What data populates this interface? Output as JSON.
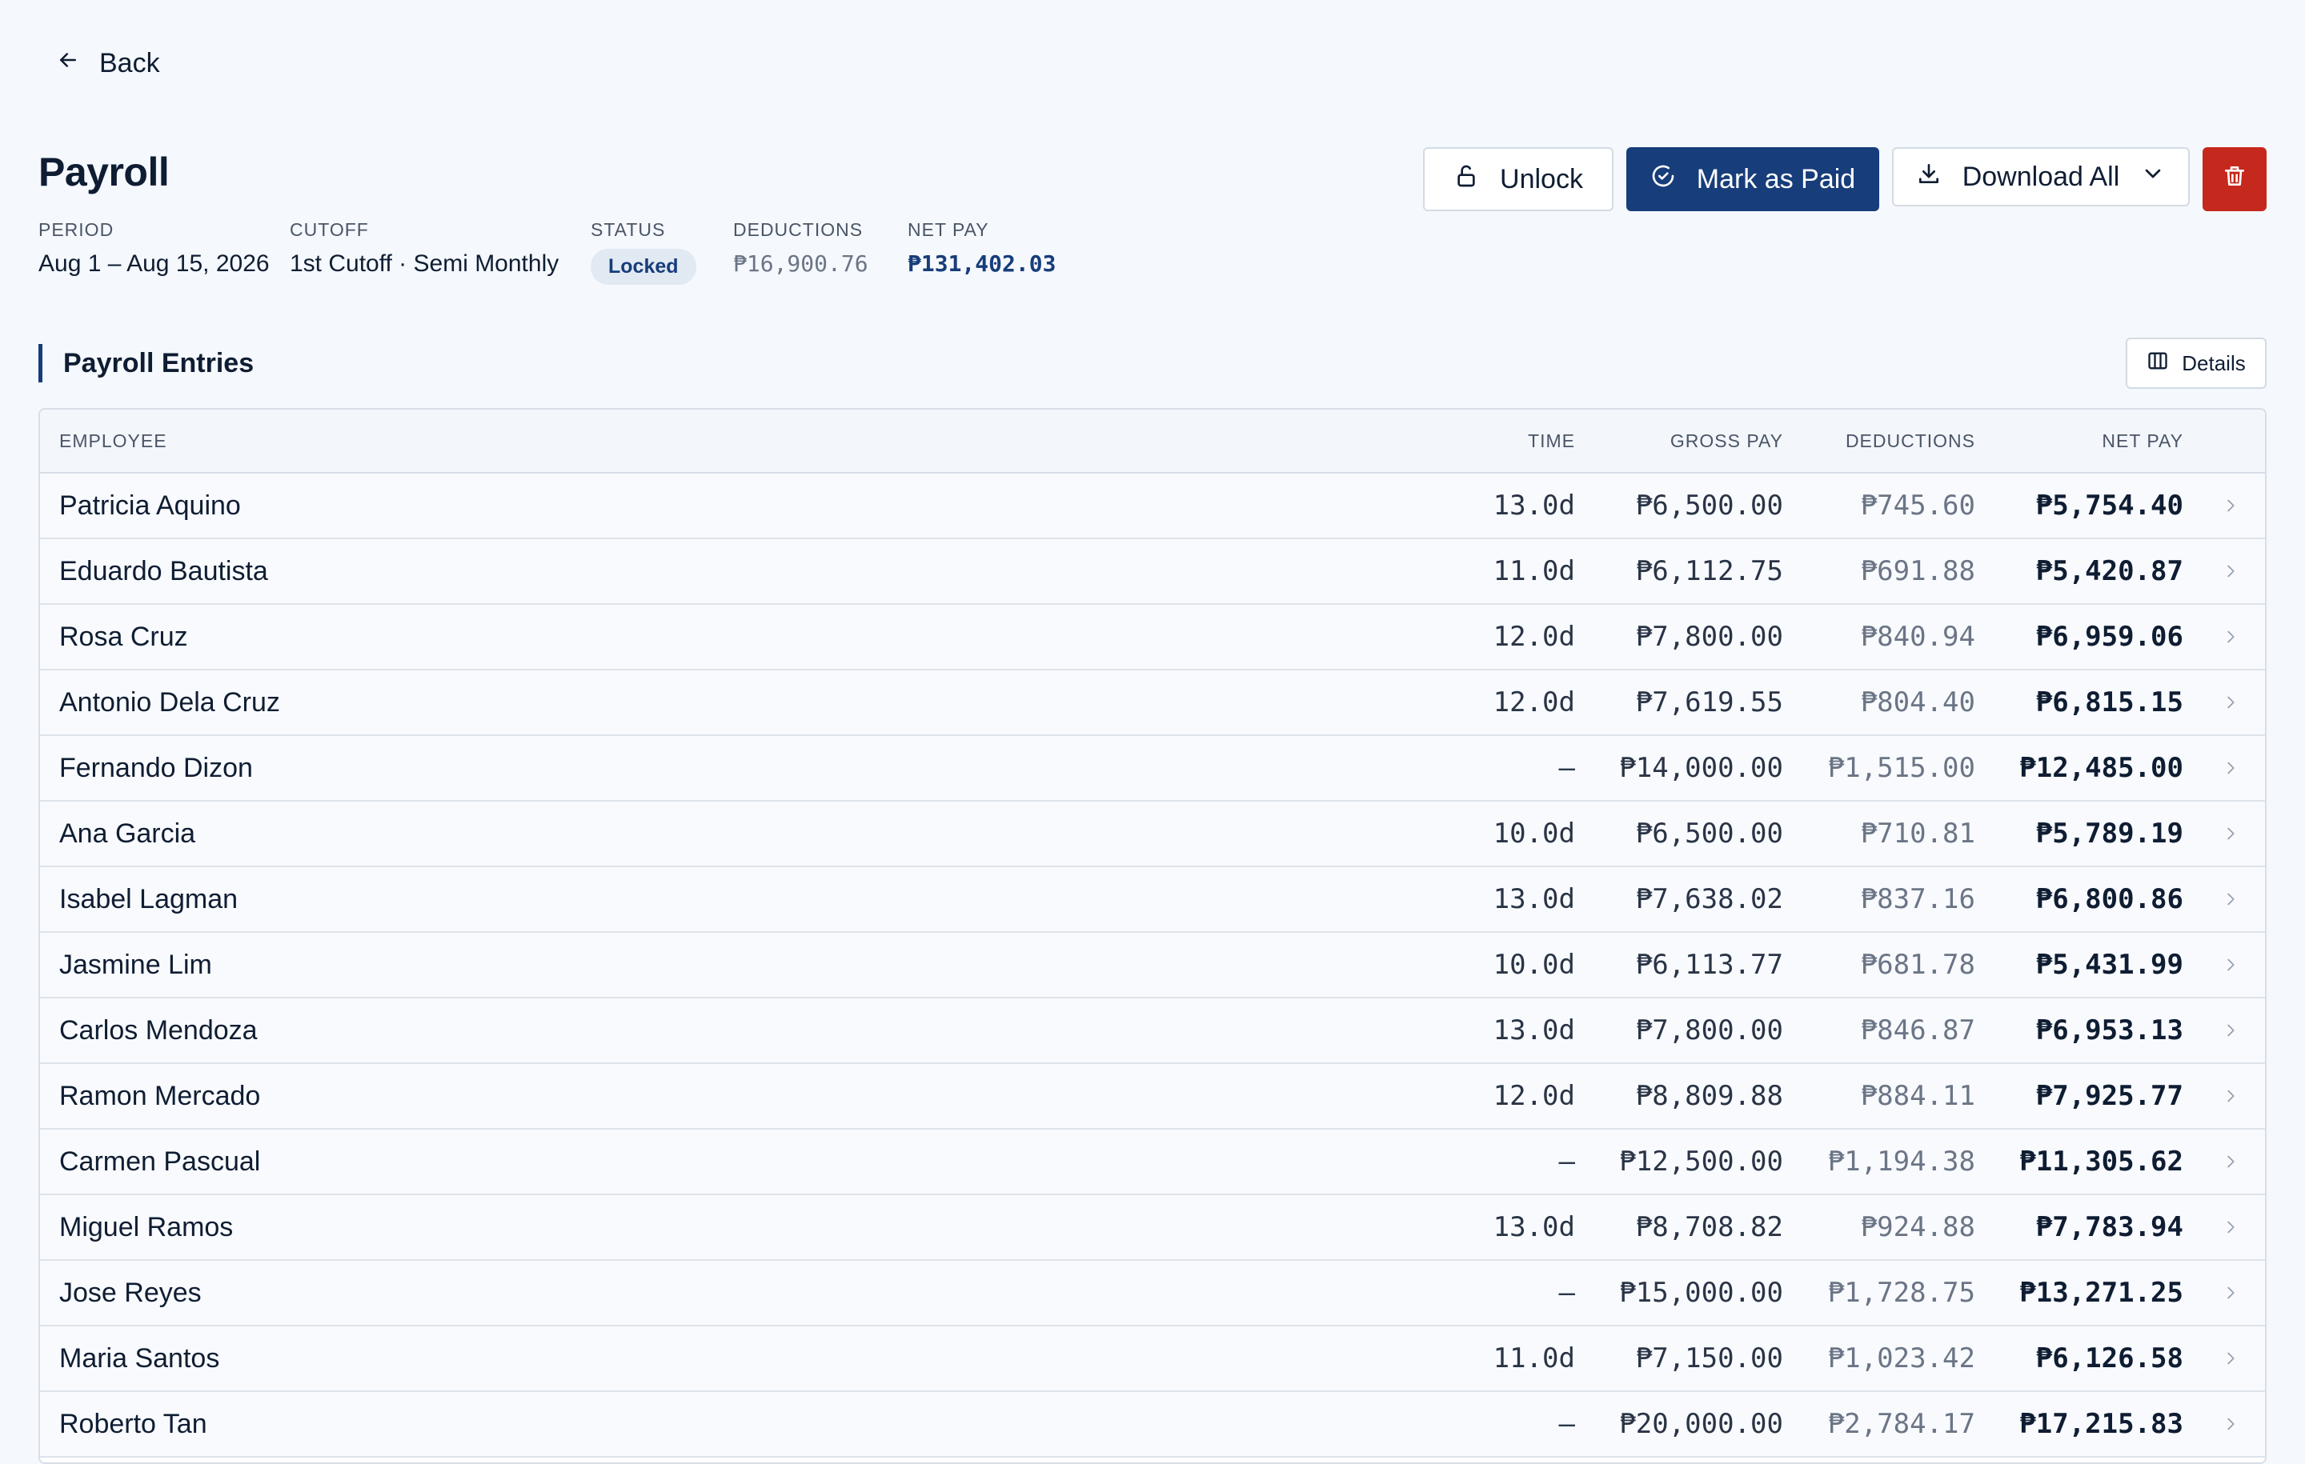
{
  "nav": {
    "back_label": "Back"
  },
  "page": {
    "title": "Payroll"
  },
  "meta": {
    "period_label": "PERIOD",
    "period_value": "Aug 1 – Aug 15, 2026",
    "cutoff_label": "CUTOFF",
    "cutoff_value": "1st Cutoff · Semi Monthly",
    "status_label": "STATUS",
    "status_value": "Locked",
    "deductions_label": "DEDUCTIONS",
    "deductions_value": "₱16,900.76",
    "netpay_label": "NET PAY",
    "netpay_value": "₱131,402.03"
  },
  "actions": {
    "unlock_label": "Unlock",
    "mark_paid_label": "Mark as Paid",
    "download_label": "Download All"
  },
  "section": {
    "title": "Payroll Entries",
    "details_label": "Details"
  },
  "table": {
    "columns": [
      "EMPLOYEE",
      "TIME",
      "GROSS PAY",
      "DEDUCTIONS",
      "NET PAY"
    ],
    "rows": [
      [
        "Patricia Aquino",
        "13.0d",
        "₱6,500.00",
        "₱745.60",
        "₱5,754.40"
      ],
      [
        "Eduardo Bautista",
        "11.0d",
        "₱6,112.75",
        "₱691.88",
        "₱5,420.87"
      ],
      [
        "Rosa Cruz",
        "12.0d",
        "₱7,800.00",
        "₱840.94",
        "₱6,959.06"
      ],
      [
        "Antonio Dela Cruz",
        "12.0d",
        "₱7,619.55",
        "₱804.40",
        "₱6,815.15"
      ],
      [
        "Fernando Dizon",
        "—",
        "₱14,000.00",
        "₱1,515.00",
        "₱12,485.00"
      ],
      [
        "Ana Garcia",
        "10.0d",
        "₱6,500.00",
        "₱710.81",
        "₱5,789.19"
      ],
      [
        "Isabel Lagman",
        "13.0d",
        "₱7,638.02",
        "₱837.16",
        "₱6,800.86"
      ],
      [
        "Jasmine Lim",
        "10.0d",
        "₱6,113.77",
        "₱681.78",
        "₱5,431.99"
      ],
      [
        "Carlos Mendoza",
        "13.0d",
        "₱7,800.00",
        "₱846.87",
        "₱6,953.13"
      ],
      [
        "Ramon Mercado",
        "12.0d",
        "₱8,809.88",
        "₱884.11",
        "₱7,925.77"
      ],
      [
        "Carmen Pascual",
        "—",
        "₱12,500.00",
        "₱1,194.38",
        "₱11,305.62"
      ],
      [
        "Miguel Ramos",
        "13.0d",
        "₱8,708.82",
        "₱924.88",
        "₱7,783.94"
      ],
      [
        "Jose Reyes",
        "—",
        "₱15,000.00",
        "₱1,728.75",
        "₱13,271.25"
      ],
      [
        "Maria Santos",
        "11.0d",
        "₱7,150.00",
        "₱1,023.42",
        "₱6,126.58"
      ],
      [
        "Roberto Tan",
        "—",
        "₱20,000.00",
        "₱2,784.17",
        "₱17,215.83"
      ]
    ]
  },
  "colors": {
    "primary": "#173d7a",
    "danger": "#c5281c",
    "background": "#f5f8fc"
  },
  "icons": [
    "arrow-left-icon",
    "unlock-icon",
    "check-circle-icon",
    "download-icon",
    "chevron-down-icon",
    "trash-icon",
    "columns-icon",
    "chevron-right-icon"
  ]
}
